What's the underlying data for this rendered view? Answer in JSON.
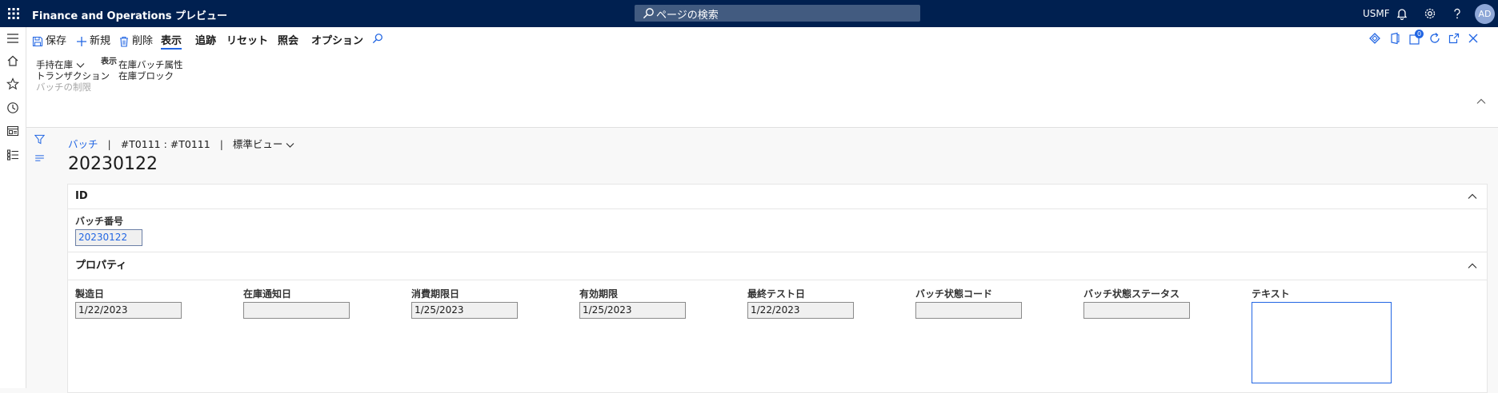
{
  "app": {
    "title": "Finance and Operations プレビュー",
    "search_placeholder": "ページの検索",
    "company": "USMF",
    "avatar_initials": "AD",
    "accent": "#002050"
  },
  "commands": {
    "save": "保存",
    "new": "新規",
    "delete": "削除",
    "view": "表示",
    "track": "追跡",
    "reset": "リセット",
    "inquiry": "照会",
    "options": "オプション"
  },
  "action_group": {
    "title": "表示",
    "items": [
      "手持在庫",
      "トランザクション",
      "バッチの制限",
      "在庫バッチ属性",
      "在庫ブロック"
    ]
  },
  "breadcrumb": {
    "link": "バッチ",
    "context": "#T0111 : #T0111",
    "view": "標準ビュー"
  },
  "record": {
    "title": "20230122"
  },
  "id_tab": {
    "header": "ID",
    "batch_number_label": "バッチ番号",
    "batch_number_value": "20230122"
  },
  "props_tab": {
    "header": "プロパティ",
    "fields": [
      {
        "label": "製造日",
        "value": "1/22/2023"
      },
      {
        "label": "在庫通知日",
        "value": ""
      },
      {
        "label": "消費期限日",
        "value": "1/25/2023"
      },
      {
        "label": "有効期限",
        "value": "1/25/2023"
      },
      {
        "label": "最終テスト日",
        "value": "1/22/2023"
      },
      {
        "label": "バッチ状態コード",
        "value": ""
      },
      {
        "label": "バッチ状態ステータス",
        "value": ""
      }
    ],
    "text_label": "テキスト",
    "text_value": ""
  },
  "badge_count": "0"
}
